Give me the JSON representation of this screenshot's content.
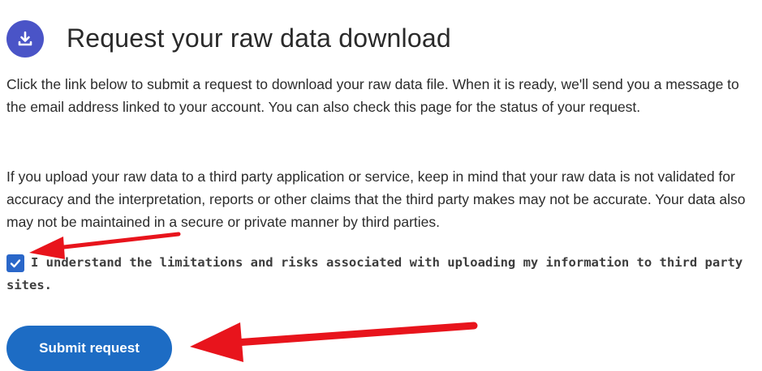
{
  "header": {
    "icon": "download-icon",
    "title": "Request your raw data download"
  },
  "content": {
    "paragraph_1": "Click the link below to submit a request to download your raw data file. When it is ready, we'll send you a message to the email address linked to your account. You can also check this page for the status of your request.",
    "paragraph_2": "If you upload your raw data to a third party application or service, keep in mind that your raw data is not validated for accuracy and the interpretation, reports or other claims that the third party makes may not be accurate. Your data also may not be maintained in a secure or private manner by third parties."
  },
  "consent": {
    "checked": true,
    "label": "I understand the limitations and risks associated with uploading my information to third party sites."
  },
  "actions": {
    "submit_label": "Submit request"
  },
  "colors": {
    "icon_bg": "#4a54c7",
    "checkbox": "#2a67c9",
    "button": "#1d6cc4",
    "annotation_arrow": "#e8141c"
  }
}
